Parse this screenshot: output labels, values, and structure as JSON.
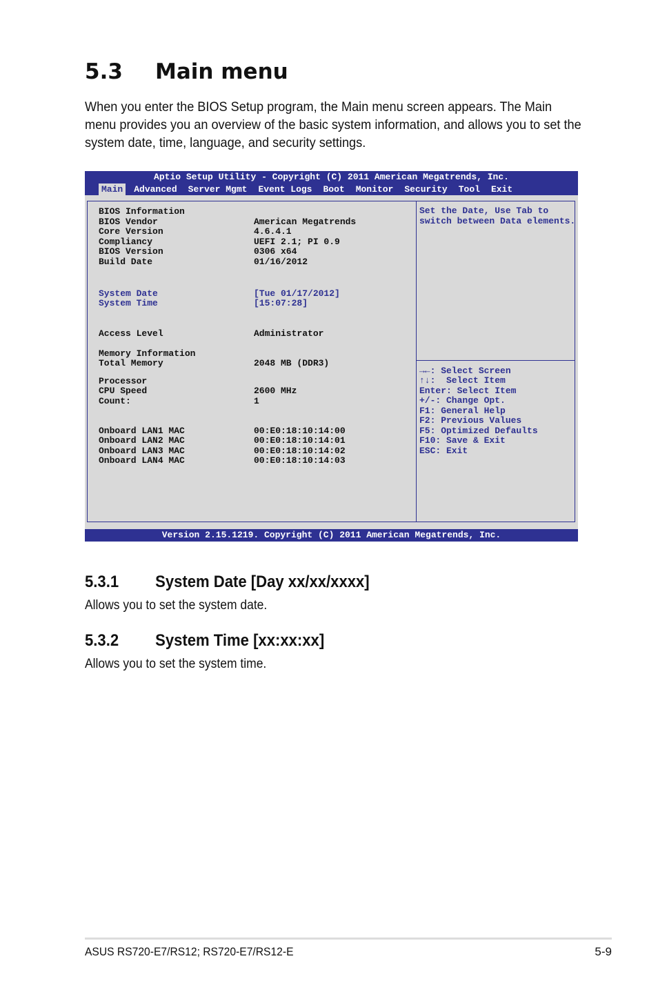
{
  "section": {
    "number": "5.3",
    "title": "Main menu"
  },
  "intro": "When you enter the BIOS Setup program, the Main menu screen appears. The Main menu provides you an overview of the basic system information, and allows you to set the system date, time, language, and security settings.",
  "bios": {
    "title": "Aptio Setup Utility - Copyright (C) 2011 American Megatrends, Inc.",
    "tabs": [
      "Main",
      "Advanced",
      "Server Mgmt",
      "Event Logs",
      "Boot",
      "Monitor",
      "Security",
      "Tool",
      "Exit"
    ],
    "active_tab": "Main",
    "rows": [
      {
        "label": "BIOS Information",
        "value": ""
      },
      {
        "label": "BIOS Vendor",
        "value": "American Megatrends"
      },
      {
        "label": "Core Version",
        "value": "4.6.4.1"
      },
      {
        "label": "Compliancy",
        "value": "UEFI 2.1; PI 0.9"
      },
      {
        "label": "BIOS Version",
        "value": "0306 x64"
      },
      {
        "label": "Build Date",
        "value": "01/16/2012"
      },
      {
        "label": "System Date",
        "value": "[Tue 01/17/2012]"
      },
      {
        "label": "System Time",
        "value": "[15:07:28]"
      },
      {
        "label": "Access Level",
        "value": "Administrator"
      },
      {
        "label": "Memory Information",
        "value": ""
      },
      {
        "label": "Total Memory",
        "value": "2048 MB (DDR3)"
      },
      {
        "label": "Processor",
        "value": ""
      },
      {
        "label": "CPU Speed",
        "value": "2600 MHz"
      },
      {
        "label": "Count:",
        "value": "1"
      },
      {
        "label": "Onboard LAN1 MAC",
        "value": "00:E0:18:10:14:00"
      },
      {
        "label": "Onboard LAN2 MAC",
        "value": "00:E0:18:10:14:01"
      },
      {
        "label": "Onboard LAN3 MAC",
        "value": "00:E0:18:10:14:02"
      },
      {
        "label": "Onboard LAN4 MAC",
        "value": "00:E0:18:10:14:03"
      }
    ],
    "help_text": [
      "Set the Date, Use Tab to",
      "switch between Data elements."
    ],
    "key_help": [
      "→←: Select Screen",
      "↑↓:  Select Item",
      "Enter: Select Item",
      "+/-: Change Opt.",
      "F1: General Help",
      "F2: Previous Values",
      "F5: Optimized Defaults",
      "F10: Save & Exit",
      "ESC: Exit"
    ],
    "footer": "Version 2.15.1219. Copyright (C) 2011 American Megatrends, Inc.",
    "colors": {
      "accent": "#2e3192",
      "background": "#d9d9d9"
    }
  },
  "subsections": [
    {
      "number": "5.3.1",
      "title": "System Date [Day xx/xx/xxxx]",
      "description": "Allows you to set the system date."
    },
    {
      "number": "5.3.2",
      "title": "System Time [xx:xx:xx]",
      "description": "Allows you to set the system time."
    }
  ],
  "footer": {
    "product": "ASUS RS720-E7/RS12; RS720-E7/RS12-E",
    "page": "5-9"
  }
}
